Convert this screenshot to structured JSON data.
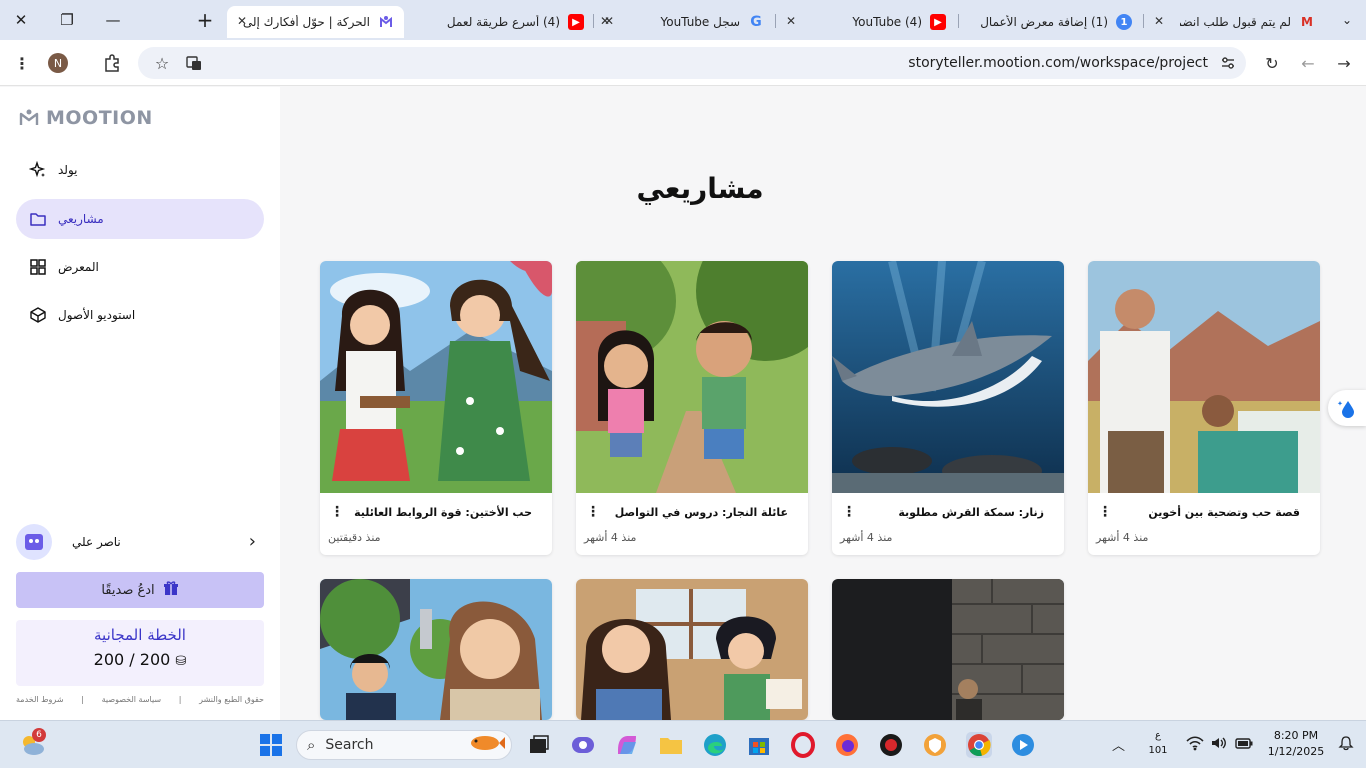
{
  "browser": {
    "tabs": [
      {
        "title": "لم يتم قبول طلب انضمام",
        "favicon": "gmail-icon",
        "color": "#d93025"
      },
      {
        "title": "(1) إضافة معرض الأعمال",
        "favicon": "notification-icon",
        "color": "#4285f4"
      },
      {
        "title": "YouTube (4)",
        "favicon": "youtube-icon",
        "color": "#ff0000"
      },
      {
        "title": "سجل YouTube",
        "favicon": "google-icon",
        "color": "#4285f4"
      },
      {
        "title": "(4) أسرع طريقة لعمل",
        "favicon": "youtube-icon",
        "color": "#ff0000"
      },
      {
        "title": "الحركة | حوّل أفكارك إلى",
        "favicon": "mootion-icon",
        "color": "#6b5ce7"
      }
    ],
    "new_tab_label": "+",
    "url": "storyteller.mootion.com/workspace/project",
    "profile_initial": "N"
  },
  "app": {
    "logo_text": "MOOTION",
    "nav": [
      {
        "label": "يولد",
        "icon": "sparkle-icon",
        "active": false
      },
      {
        "label": "مشاريعي",
        "icon": "folder-icon",
        "active": true
      },
      {
        "label": "المعرض",
        "icon": "grid-icon",
        "active": false
      },
      {
        "label": "استوديو الأصول",
        "icon": "cube-icon",
        "active": false
      }
    ],
    "user_name": "ناصر علي",
    "invite_label": "ادعُ صديقًا",
    "plan_name": "الخطة المجانية",
    "plan_credits": "200 / 200",
    "footer_links": [
      "شروط الخدمة",
      "سياسة الخصوصية",
      "حقوق الطبع والنشر"
    ],
    "footer_separator": "|"
  },
  "main": {
    "title": "مشاريعي",
    "projects": [
      {
        "title": "قصة حب وتضحية بين أخوين",
        "date": "منذ 4 أشهر"
      },
      {
        "title": "زنار: سمكة القرش مطلوبة",
        "date": "منذ 4 أشهر"
      },
      {
        "title": "عائلة النجار: دروس في التواصل",
        "date": "منذ 4 أشهر"
      },
      {
        "title": "حب الأختين: قوة الروابط العائلية",
        "date": "منذ دقيقتين"
      }
    ]
  },
  "taskbar": {
    "search_label": "Search",
    "weather_badge": "6",
    "lang_top": "ع",
    "lang_bottom": "101",
    "time": "8:20 PM",
    "date": "1/12/2025"
  }
}
